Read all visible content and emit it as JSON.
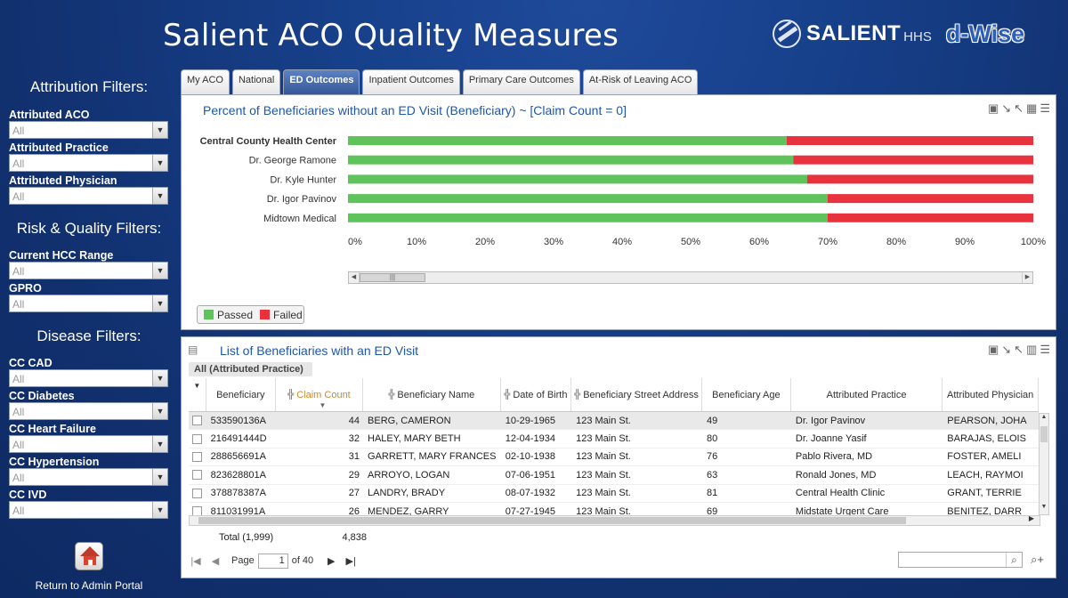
{
  "header": {
    "title": "Salient ACO Quality Measures",
    "brand_name": "SALIENT",
    "brand_hhs": "HHS",
    "brand_dwise": "d-Wise"
  },
  "sidebar": {
    "attribution_title": "Attribution Filters:",
    "attribution_filters": [
      {
        "label": "Attributed ACO",
        "value": "All"
      },
      {
        "label": "Attributed Practice",
        "value": "All"
      },
      {
        "label": "Attributed Physician",
        "value": "All"
      }
    ],
    "risk_title": "Risk & Quality Filters:",
    "risk_filters": [
      {
        "label": "Current HCC Range",
        "value": "All"
      },
      {
        "label": "GPRO",
        "value": "All"
      }
    ],
    "disease_title": "Disease Filters:",
    "disease_filters": [
      {
        "label": "CC CAD",
        "value": "All"
      },
      {
        "label": "CC Diabetes",
        "value": "All"
      },
      {
        "label": "CC Heart Failure",
        "value": "All"
      },
      {
        "label": "CC Hypertension",
        "value": "All"
      },
      {
        "label": "CC IVD",
        "value": "All"
      }
    ],
    "return_label": "Return to Admin Portal"
  },
  "tabs": [
    {
      "label": "My ACO",
      "active": false
    },
    {
      "label": "National",
      "active": false
    },
    {
      "label": "ED Outcomes",
      "active": true
    },
    {
      "label": "Inpatient Outcomes",
      "active": false
    },
    {
      "label": "Primary Care Outcomes",
      "active": false
    },
    {
      "label": "At-Risk of Leaving ACO",
      "active": false
    }
  ],
  "chart_panel": {
    "title": "Percent of Beneficiaries without an ED Visit (Beneficiary) ~ [Claim Count = 0]"
  },
  "chart_data": {
    "type": "bar",
    "orientation": "horizontal",
    "stacked": true,
    "categories": [
      "Central County Health Center",
      "Dr. George Ramone",
      "Dr. Kyle Hunter",
      "Dr. Igor Pavinov",
      "Midtown Medical"
    ],
    "series": [
      {
        "name": "Passed",
        "color": "#5dc35a",
        "values": [
          64,
          65,
          67,
          70,
          70
        ]
      },
      {
        "name": "Failed",
        "color": "#e8333f",
        "values": [
          36,
          35,
          33,
          30,
          30
        ]
      }
    ],
    "x_ticks": [
      "0%",
      "10%",
      "20%",
      "30%",
      "40%",
      "50%",
      "60%",
      "70%",
      "80%",
      "90%",
      "100%"
    ],
    "xlim": [
      0,
      100
    ],
    "legend": "bottom-left",
    "grid": false
  },
  "list_panel": {
    "title": "List of Beneficiaries with an ED Visit",
    "breadcrumb": "All (Attributed Practice)",
    "columns": [
      "Beneficiary",
      "Claim Count",
      "Beneficiary Name",
      "Date of Birth",
      "Beneficiary Street Address",
      "Beneficiary Age",
      "Attributed Practice",
      "Attributed Physician"
    ],
    "rows": [
      [
        "533590136A",
        "44",
        "BERG, CAMERON",
        "10-29-1965",
        "123 Main St.",
        "49",
        "Dr. Igor Pavinov",
        "PEARSON, JOHA"
      ],
      [
        "216491444D",
        "32",
        "HALEY, MARY BETH",
        "12-04-1934",
        "123 Main St.",
        "80",
        "Dr. Joanne Yasif",
        "BARAJAS, ELOIS"
      ],
      [
        "288656691A",
        "31",
        "GARRETT, MARY FRANCES",
        "02-10-1938",
        "123 Main St.",
        "76",
        "Pablo Rivera, MD",
        "FOSTER, AMELI"
      ],
      [
        "823628801A",
        "29",
        "ARROYO, LOGAN",
        "07-06-1951",
        "123 Main St.",
        "63",
        "Ronald Jones, MD",
        "LEACH, RAYMOI"
      ],
      [
        "378878387A",
        "27",
        "LANDRY, BRADY",
        "08-07-1932",
        "123 Main St.",
        "81",
        "Central Health Clinic",
        "GRANT, TERRIE"
      ],
      [
        "811031991A",
        "26",
        "MENDEZ, GARRY",
        "07-27-1945",
        "123 Main St.",
        "69",
        "Midstate Urgent Care",
        "BENITEZ, DARR"
      ]
    ],
    "total_label": "Total (1,999)",
    "total_claims": "4,838",
    "pager": {
      "page_label": "Page",
      "page": "1",
      "of_label": "of 40"
    }
  }
}
